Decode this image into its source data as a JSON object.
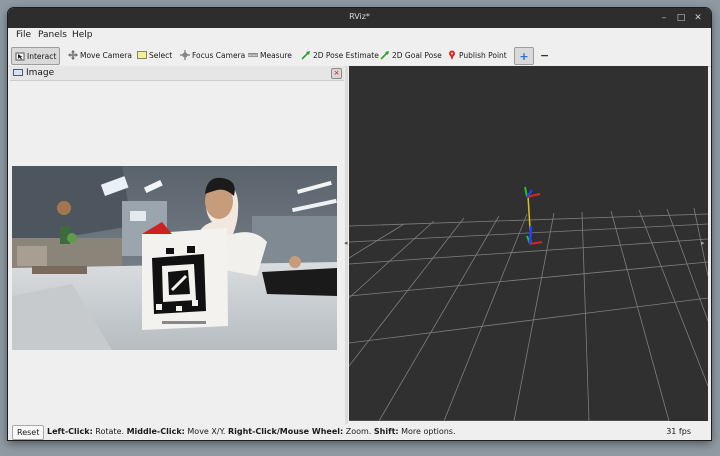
{
  "window": {
    "title": "RViz*",
    "minimize": "–",
    "maximize": "□",
    "close": "✕"
  },
  "menu": [
    "File",
    "Panels",
    "Help"
  ],
  "toolbar": {
    "interact": "Interact",
    "move_camera": "Move Camera",
    "select": "Select",
    "focus_camera": "Focus Camera",
    "measure": "Measure",
    "pose_estimate": "2D Pose Estimate",
    "goal_pose": "2D Goal Pose",
    "publish_point": "Publish Point",
    "add": "+",
    "remove": "−"
  },
  "image_panel": {
    "title": "Image"
  },
  "status": {
    "reset": "Reset",
    "k1": "Left-Click:",
    "v1": " Rotate. ",
    "k2": "Middle-Click:",
    "v2": " Move X/Y. ",
    "k3": "Right-Click/Mouse Wheel:",
    "v3": " Zoom. ",
    "k4": "Shift:",
    "v4": " More options.",
    "fps": "31 fps"
  },
  "colors": {
    "titlebar": "#2d2d2d",
    "viewport": "#303030",
    "grid": "#a0a0a0",
    "axis_x": "#e02020",
    "axis_y": "#20c020",
    "axis_z": "#2040ff"
  },
  "icons": {
    "interact": "cursor-icon",
    "move_camera": "move-arrows-icon",
    "select": "select-box-icon",
    "focus_camera": "crosshair-icon",
    "measure": "ruler-icon",
    "pose_estimate": "green-arrow-icon",
    "goal_pose": "green-arrow-icon",
    "publish_point": "red-pin-icon"
  }
}
